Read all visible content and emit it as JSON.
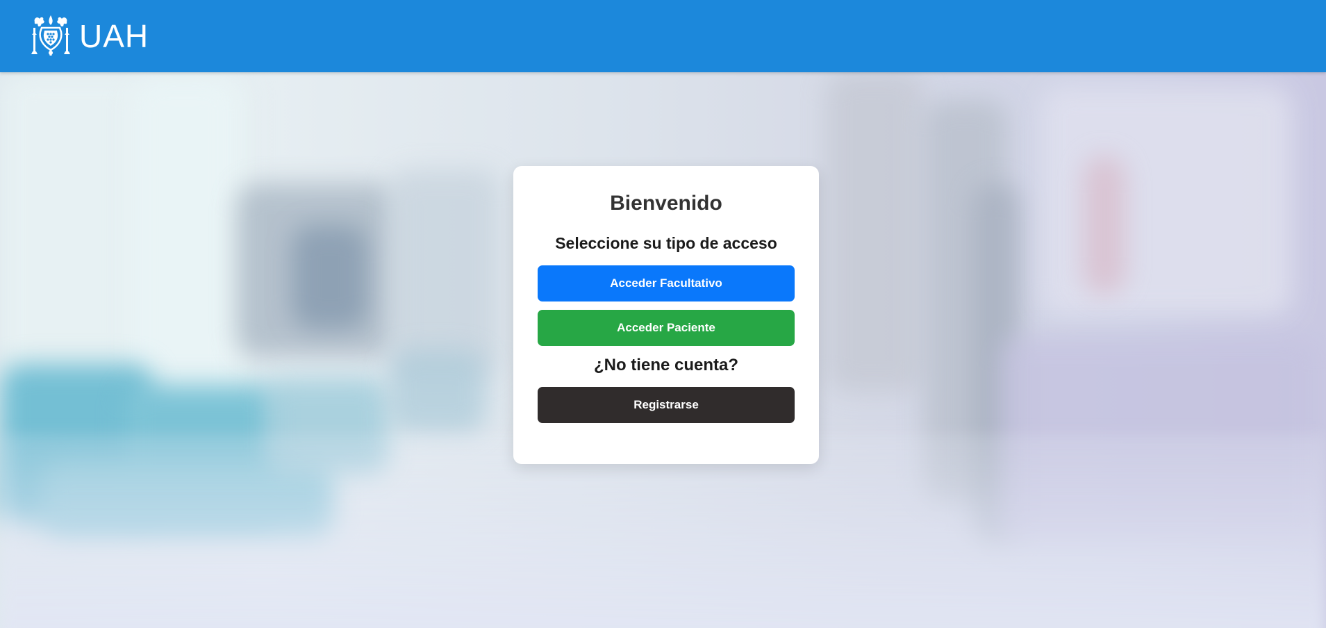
{
  "header": {
    "brand_name": "UAH",
    "logo_icon": "uah-crest-icon",
    "bar_color": "#1c88db"
  },
  "card": {
    "title": "Bienvenido",
    "subtitle": "Seleccione su tipo de acceso",
    "facultativo_button": "Acceder Facultativo",
    "paciente_button": "Acceder Paciente",
    "no_account_prompt": "¿No tiene cuenta?",
    "register_button": "Registrarse"
  },
  "colors": {
    "facultativo": "#0a78fb",
    "paciente": "#27a745",
    "register": "#302c2c"
  }
}
